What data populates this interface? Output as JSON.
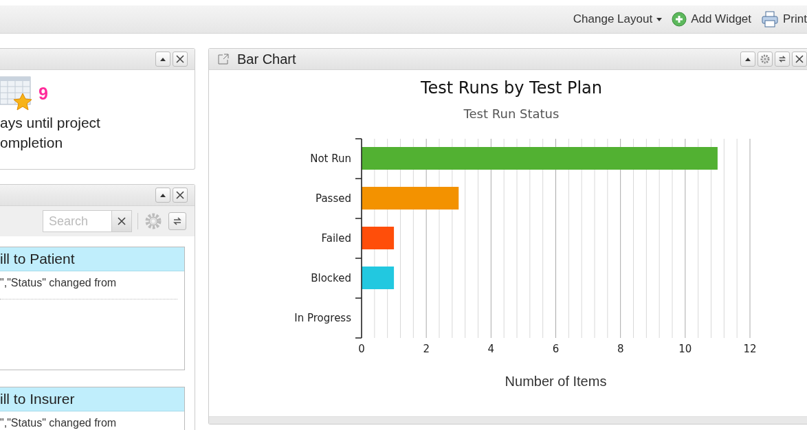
{
  "toolbar": {
    "change_layout": "Change Layout",
    "add_widget": "Add Widget",
    "print": "Print"
  },
  "countdown_widget": {
    "count": "9",
    "text_line_1": "ays until project",
    "text_line_2": "ompletion"
  },
  "activity_widget": {
    "search": {
      "placeholder": "Search"
    },
    "entries": [
      {
        "title": "ill to Patient",
        "detail": "\",\"Status\" changed from"
      },
      {
        "title": "ill to Insurer",
        "detail": "\",\"Status\" changed from"
      }
    ]
  },
  "bar_chart_widget": {
    "title": "Bar Chart",
    "chart_data": {
      "type": "bar",
      "orientation": "horizontal",
      "title": "Test Runs by Test Plan",
      "xlabel": "Number of Items",
      "categories": [
        "Not Run",
        "Passed",
        "Failed",
        "Blocked",
        "In Progress"
      ],
      "series": [
        {
          "name": "Test Run Status",
          "colors": [
            "#52b132",
            "#f39200",
            "#ff4e0a",
            "#22c8e0",
            null
          ],
          "values": [
            11,
            3,
            1,
            1,
            0
          ]
        }
      ],
      "grid": true,
      "xlim": [
        0,
        12
      ],
      "xticks": [
        0,
        2,
        4,
        6,
        8,
        10,
        12
      ]
    }
  }
}
